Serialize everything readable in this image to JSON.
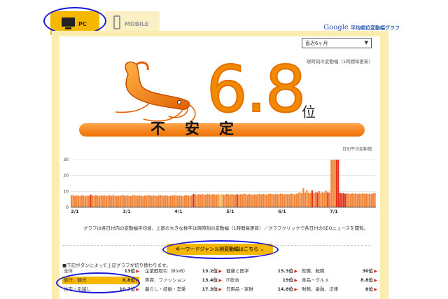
{
  "header": {
    "tabs": [
      {
        "label": "PC",
        "icon": "desktop-monitor-icon",
        "active": true
      },
      {
        "label": "MOBILE",
        "icon": "mobile-phone-icon",
        "active": false
      }
    ],
    "brand_google": "Google",
    "brand_title": "平均順位変動幅グラフ"
  },
  "period_select": {
    "value": "直近6ヶ月"
  },
  "current": {
    "label": "現時刻の変動幅（1時間毎更新）",
    "value": "6.8",
    "unit": "位",
    "status": "不安定"
  },
  "chart_caption": "日別平均変動幅",
  "chart_data": {
    "type": "bar",
    "x_ticks": [
      "2/1",
      "3/1",
      "4/1",
      "5/1",
      "6/1",
      "7/1"
    ],
    "y_ticks": [
      0,
      10,
      20,
      30
    ],
    "ylim": [
      0,
      30
    ],
    "highlight_color": "#e5301c",
    "base_color": "#f0863a",
    "values": [
      7.5,
      7.6,
      7.2,
      7.4,
      7.3,
      7.1,
      7.6,
      7.3,
      7.0,
      7.4,
      7.2,
      8.0,
      7.5,
      7.3,
      7.6,
      7.4,
      7.2,
      7.5,
      7.3,
      7.6,
      7.1,
      7.4,
      7.5,
      7.2,
      7.6,
      7.3,
      7.0,
      7.4,
      7.3,
      7.6,
      7.5,
      7.2,
      7.4,
      7.3,
      7.1,
      7.5,
      7.6,
      7.4,
      7.2,
      7.5,
      7.3,
      7.0,
      7.4,
      7.3,
      7.6,
      7.5,
      7.2,
      7.4,
      7.3,
      7.1,
      7.5,
      7.6,
      7.4,
      7.2,
      7.5,
      7.3,
      7.0,
      7.4,
      7.3,
      7.6,
      7.5,
      7.2,
      7.4,
      7.3,
      7.1,
      7.5,
      7.6,
      7.4,
      7.2,
      7.5,
      8.4,
      8.1,
      7.9,
      8.2,
      8.0,
      8.3,
      8.1,
      7.9,
      8.5,
      8.2,
      8.0,
      8.3,
      8.1,
      7.9,
      8.2,
      8.0,
      8.3,
      8.1,
      7.9,
      8.4,
      8.2,
      8.0,
      8.3,
      8.1,
      7.9,
      8.2,
      8.0,
      8.3,
      8.1,
      8.6,
      8.2,
      8.0,
      8.3,
      8.1,
      7.9,
      8.2,
      8.0,
      8.3,
      8.5,
      8.1,
      8.4,
      8.2,
      8.0,
      8.3,
      8.6,
      8.4,
      8.1,
      8.5,
      8.2,
      8.3,
      8.6,
      8.4,
      8.1,
      8.5,
      8.2,
      8.3,
      8.6,
      8.4,
      8.1,
      8.5,
      9.0,
      9.4,
      8.8,
      12.0,
      9.2,
      10.8,
      9.1,
      8.9,
      10.6,
      9.0,
      9.6,
      9.3,
      10.2,
      9.1,
      9.6,
      9.2,
      10.6,
      9.4,
      9.2,
      30.0,
      30.0,
      30.0,
      30.0,
      30.0,
      9.0,
      8.7,
      8.9,
      8.5,
      8.8,
      8.6,
      8.4,
      8.8,
      8.5,
      8.7,
      8.3,
      8.6,
      8.4,
      8.8,
      8.5,
      8.7,
      8.3,
      8.6,
      8.4,
      8.8,
      9.0
    ],
    "highlight_index": [
      11,
      70,
      95,
      138,
      141,
      147,
      152,
      153,
      154,
      155,
      156,
      157,
      175
    ],
    "light_index": [
      85,
      86
    ]
  },
  "chart_note": "グラフは各日付内の変動幅平均値、上部の大きな数字は現時刻の変動幅（1時間毎更新）／グラフクリックで各日付のSEOニュースを閲覧。",
  "genre_button": "キーワードジャンル別変動幅はこちら",
  "switch_note": "■下記ボタンによって上記グラフが切り替わります。",
  "genres": [
    [
      {
        "name": "全体",
        "value": "13位"
      },
      {
        "name": "企業間取引（BtoB）",
        "value": "13.2位"
      },
      {
        "name": "健康と医学",
        "value": "15.3位"
      },
      {
        "name": "就職、転職",
        "value": "30位"
      }
    ],
    [
      {
        "name": "旅行、観光",
        "value": "6.8位",
        "active": true
      },
      {
        "name": "美容、ファッション",
        "value": "13.4位"
      },
      {
        "name": "IT総合",
        "value": "19位"
      },
      {
        "name": "食品・グルメ",
        "value": "8.8位"
      }
    ],
    [
      {
        "name": "住宅・引越し",
        "value": "10.7位"
      },
      {
        "name": "暮らし・結婚・恋愛",
        "value": "17.3位"
      },
      {
        "name": "日用品・家財",
        "value": "14.8位"
      },
      {
        "name": "財務、金融、法律",
        "value": "8位"
      }
    ]
  ]
}
